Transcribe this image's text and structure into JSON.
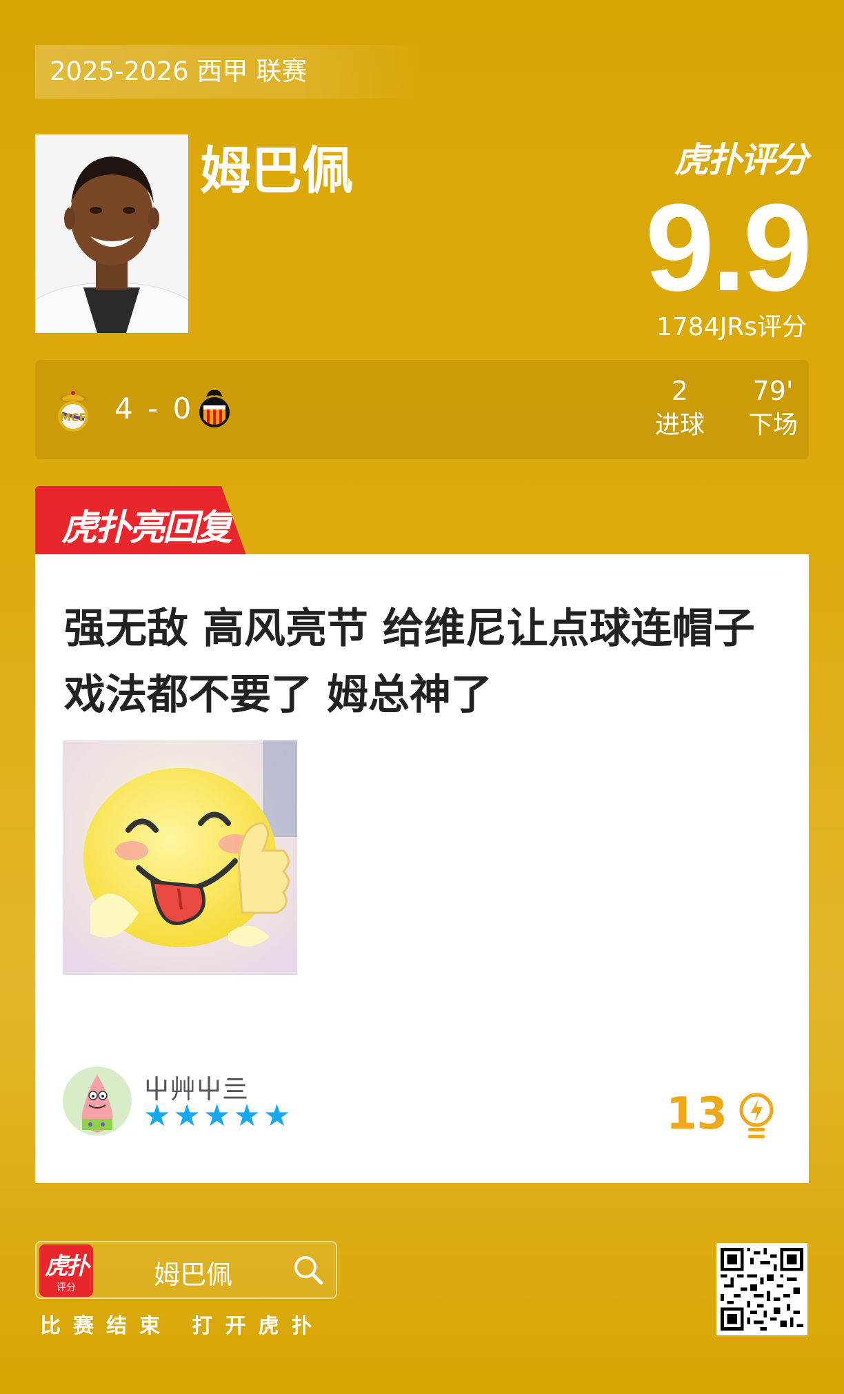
{
  "header": {
    "season": "2025-2026 西甲 联赛",
    "player_name": "姆巴佩",
    "brand": "虎扑评分",
    "rating": "9.9",
    "rating_count": "1784JRs评分"
  },
  "match": {
    "score": "4 - 0",
    "home_crest_icon": "real-madrid-crest-icon",
    "away_crest_icon": "valencia-crest-icon",
    "stats": [
      {
        "value": "2",
        "label": "进球"
      },
      {
        "value": "79'",
        "label": "下场"
      }
    ]
  },
  "reply": {
    "tab_label": "虎扑亮回复",
    "comment": "强无敌 高风亮节 给维尼让点球连帽子戏法都不要了 姆总神了",
    "username": "屮艸屮亖",
    "stars": 5,
    "likes": "13"
  },
  "footer": {
    "logo_text": "虎扑",
    "logo_sub": "评分",
    "search_text": "姆巴佩",
    "tagline": "比赛结束 打开虎扑"
  },
  "colors": {
    "background": "#D9A606",
    "accent_red": "#E8262B",
    "star_blue": "#17A9F0",
    "likes_orange": "#F0A81B"
  }
}
